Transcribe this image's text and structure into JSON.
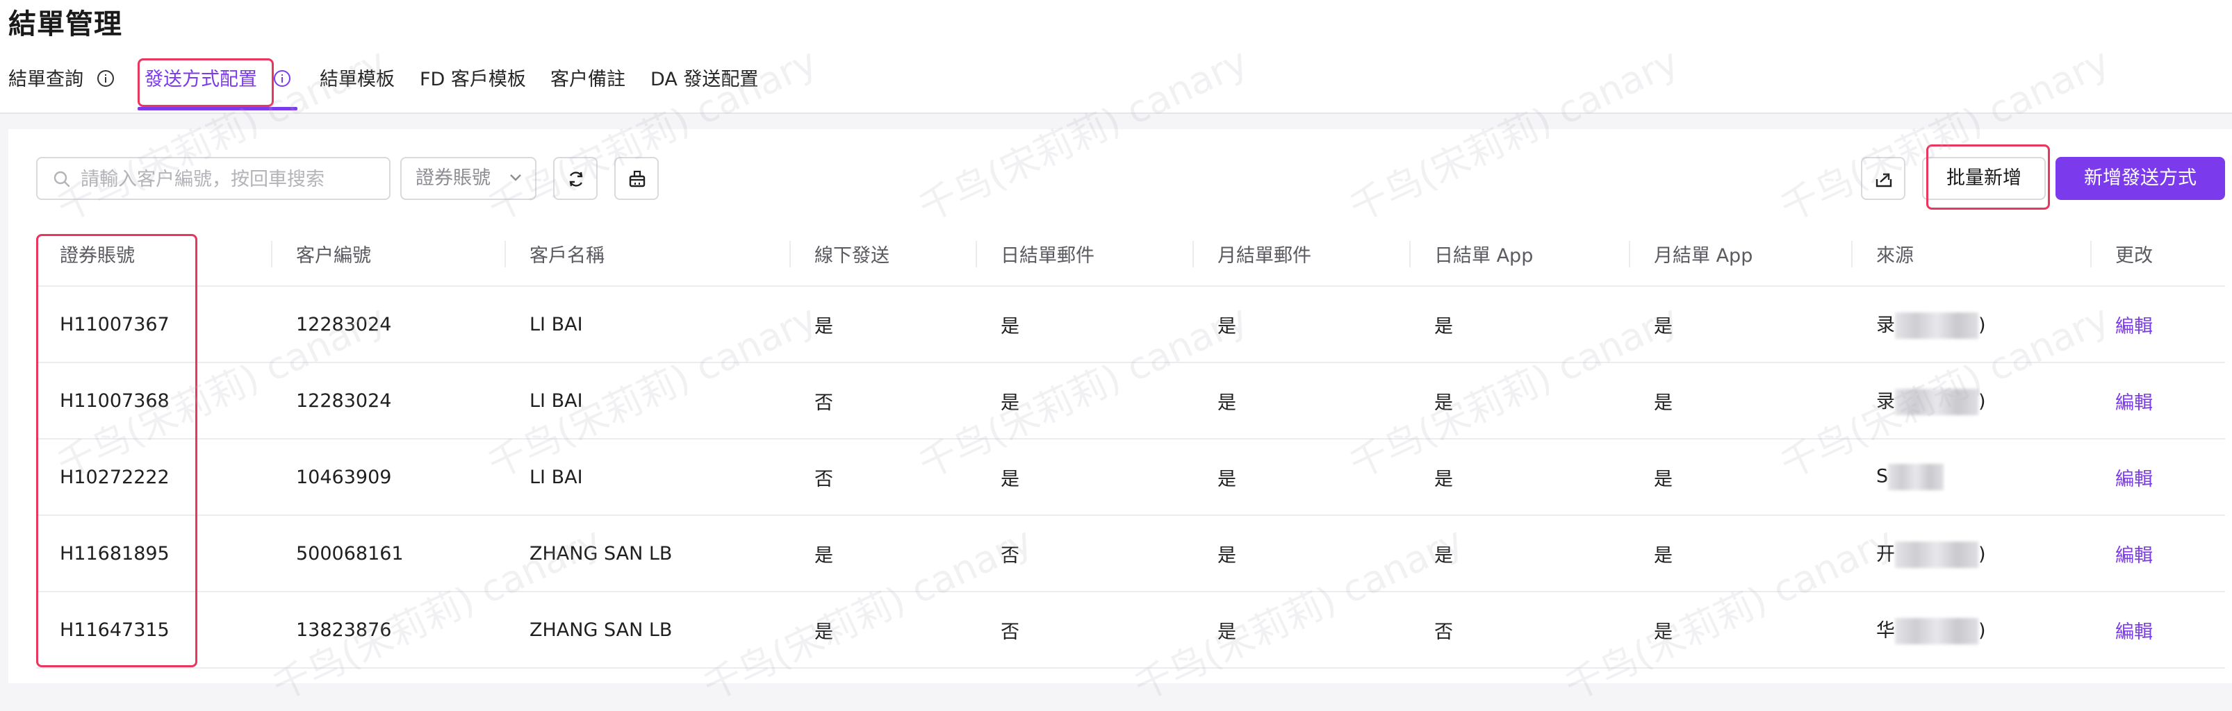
{
  "page": {
    "title": "結單管理"
  },
  "tabs": [
    {
      "label": "結單查詢",
      "has_info": true,
      "active": false
    },
    {
      "label": "發送方式配置",
      "has_info": true,
      "active": true
    },
    {
      "label": "結單模板",
      "active": false
    },
    {
      "label": "FD 客戶模板",
      "active": false
    },
    {
      "label": "客户備註",
      "active": false
    },
    {
      "label": "DA 發送配置",
      "active": false
    }
  ],
  "toolbar": {
    "search_placeholder": "請輸入客户編號，按回車搜索",
    "account_select": "證券賬號",
    "refresh_icon": "refresh-icon",
    "clear_icon": "clear-basket-icon",
    "export_icon": "export-icon",
    "batch_add_label": "批量新增",
    "add_label": "新增發送方式"
  },
  "table": {
    "columns": [
      "證券賬號",
      "客户編號",
      "客戶名稱",
      "線下發送",
      "日結單郵件",
      "月結單郵件",
      "日結單 App",
      "月結單 App",
      "來源",
      "更改"
    ],
    "rows": [
      [
        "H11007367",
        "12283024",
        "LI BAI",
        "是",
        "是",
        "是",
        "是",
        "是",
        "录",
        ")",
        "編輯"
      ],
      [
        "H11007368",
        "12283024",
        "LI BAI",
        "否",
        "是",
        "是",
        "是",
        "是",
        "录",
        ")",
        "編輯"
      ],
      [
        "H10272222",
        "10463909",
        "LI BAI",
        "否",
        "是",
        "是",
        "是",
        "是",
        "S",
        "",
        "編輯"
      ],
      [
        "H11681895",
        "500068161",
        "ZHANG SAN LB",
        "是",
        "否",
        "是",
        "是",
        "是",
        "开",
        ")",
        "編輯"
      ],
      [
        "H11647315",
        "13823876",
        "ZHANG SAN LB",
        "是",
        "否",
        "是",
        "否",
        "是",
        "华",
        ")",
        "編輯"
      ]
    ]
  },
  "watermark": "千鸟(宋莉莉) canary",
  "colors": {
    "accent": "#7c3aed",
    "highlight": "#e8375e"
  }
}
